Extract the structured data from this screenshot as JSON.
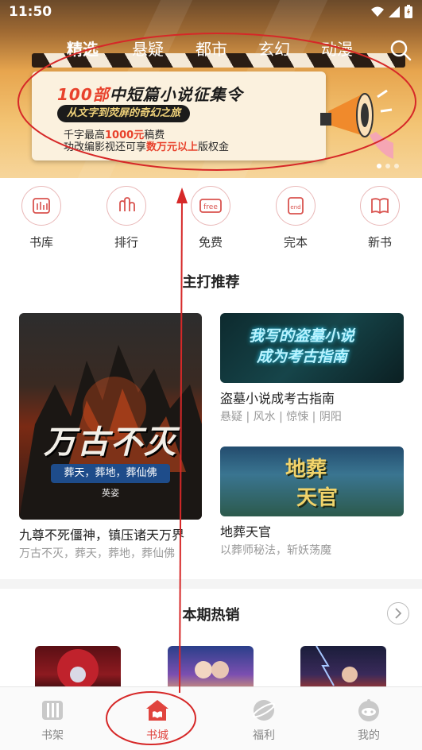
{
  "status_bar": {
    "time": "11:50"
  },
  "nav": {
    "tabs": [
      "精选",
      "悬疑",
      "都市",
      "玄幻",
      "动漫"
    ],
    "active_index": 0
  },
  "banner": {
    "headline_number": "100部",
    "headline_rest": "中短篇小说征集令",
    "subtitle": "从文字到荧屏的奇幻之旅",
    "line1_prefix": "千字最高",
    "line1_highlight": "1000元",
    "line1_suffix": "稿费",
    "line2_prefix": "功改编影视还可享",
    "line2_highlight": "数万元以上",
    "line2_suffix": "版权金",
    "page_count": 3,
    "current_page": 1
  },
  "categories": [
    {
      "label": "书库",
      "icon": "book-library-icon"
    },
    {
      "label": "排行",
      "icon": "ranking-icon"
    },
    {
      "label": "免费",
      "icon": "free-icon"
    },
    {
      "label": "完本",
      "icon": "completed-icon"
    },
    {
      "label": "新书",
      "icon": "new-book-icon"
    }
  ],
  "featured": {
    "title": "主打推荐",
    "main_book": {
      "cover_title": "万古不灭",
      "cover_subtitle": "葬天，葬地，葬仙佛",
      "cover_author": "英姿",
      "title": "九尊不死僵神，镇压诸天万界",
      "desc": "万古不灭，葬天，葬地，葬仙佛"
    },
    "side_books": [
      {
        "cover_title_line1": "我写的盗墓小说",
        "cover_title_line2": "成为考古指南",
        "title": "盗墓小说成考古指南",
        "desc": "悬疑 | 风水 | 惊悚 | 阴阳"
      },
      {
        "cover_title_line1": "地葬",
        "cover_title_line2": "天官",
        "title": "地葬天官",
        "desc": "以葬师秘法，斩妖荡魔"
      }
    ]
  },
  "hot": {
    "title": "本期热销"
  },
  "bottom_nav": [
    {
      "label": "书架",
      "icon": "bookshelf-icon"
    },
    {
      "label": "书城",
      "icon": "bookstore-icon"
    },
    {
      "label": "福利",
      "icon": "welfare-icon"
    },
    {
      "label": "我的",
      "icon": "profile-icon"
    }
  ],
  "bottom_nav_active": 1,
  "colors": {
    "accent": "#e0443e",
    "annotation": "#d62828"
  }
}
